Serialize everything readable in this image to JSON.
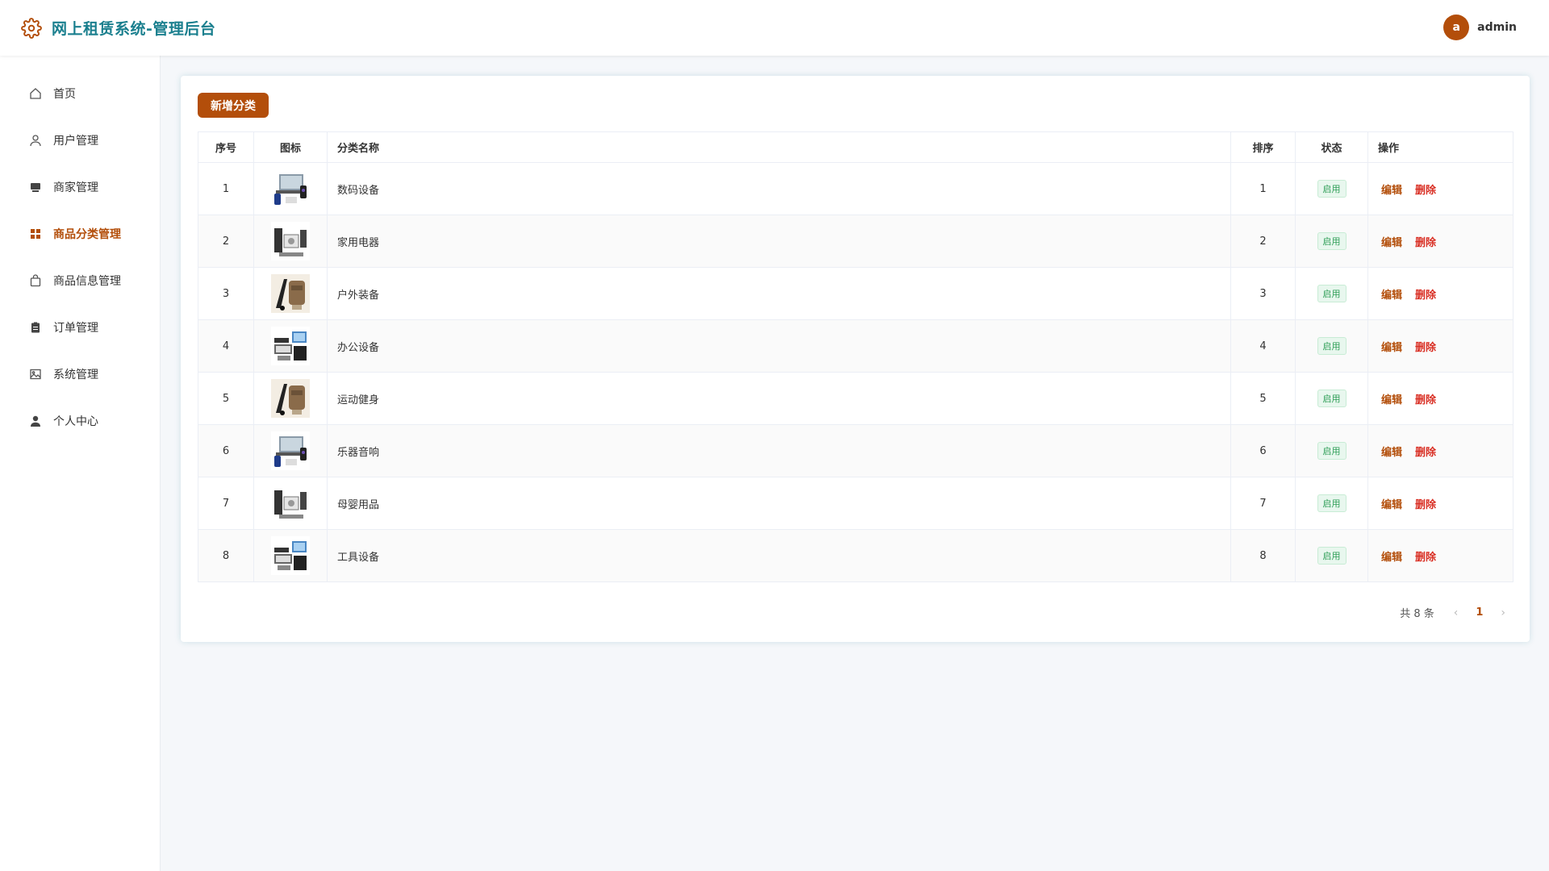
{
  "header": {
    "title": "网上租赁系统-管理后台",
    "brand_icon": "gear-icon",
    "user": {
      "avatar_letter": "a",
      "name": "admin"
    }
  },
  "colors": {
    "accent": "#b34e0a",
    "brand": "#1a7f8e",
    "success": "#2e9e57",
    "danger": "#d93025"
  },
  "sidebar": {
    "items": [
      {
        "label": "首页",
        "icon": "home-icon",
        "active": false
      },
      {
        "label": "用户管理",
        "icon": "user-icon",
        "active": false
      },
      {
        "label": "商家管理",
        "icon": "store-icon",
        "active": false
      },
      {
        "label": "商品分类管理",
        "icon": "grid-icon",
        "active": true
      },
      {
        "label": "商品信息管理",
        "icon": "shopping-bag-icon",
        "active": false
      },
      {
        "label": "订单管理",
        "icon": "clipboard-icon",
        "active": false
      },
      {
        "label": "系统管理",
        "icon": "image-icon",
        "active": false
      },
      {
        "label": "个人中心",
        "icon": "person-icon",
        "active": false
      }
    ]
  },
  "main": {
    "add_button": "新增分类",
    "table": {
      "headers": {
        "index": "序号",
        "icon": "图标",
        "name": "分类名称",
        "sort": "排序",
        "status": "状态",
        "actions": "操作"
      },
      "rows": [
        {
          "index": "1",
          "image": "electronics-thumbnail",
          "name": "数码设备",
          "sort": "1",
          "status": "启用",
          "edit": "编辑",
          "delete": "删除"
        },
        {
          "index": "2",
          "image": "appliance-thumbnail",
          "name": "家用电器",
          "sort": "2",
          "status": "启用",
          "edit": "编辑",
          "delete": "删除"
        },
        {
          "index": "3",
          "image": "outdoor-thumbnail",
          "name": "户外装备",
          "sort": "3",
          "status": "启用",
          "edit": "编辑",
          "delete": "删除"
        },
        {
          "index": "4",
          "image": "office-thumbnail",
          "name": "办公设备",
          "sort": "4",
          "status": "启用",
          "edit": "编辑",
          "delete": "删除"
        },
        {
          "index": "5",
          "image": "outdoor-thumbnail",
          "name": "运动健身",
          "sort": "5",
          "status": "启用",
          "edit": "编辑",
          "delete": "删除"
        },
        {
          "index": "6",
          "image": "electronics-thumbnail",
          "name": "乐器音响",
          "sort": "6",
          "status": "启用",
          "edit": "编辑",
          "delete": "删除"
        },
        {
          "index": "7",
          "image": "appliance-thumbnail",
          "name": "母婴用品",
          "sort": "7",
          "status": "启用",
          "edit": "编辑",
          "delete": "删除"
        },
        {
          "index": "8",
          "image": "office-thumbnail",
          "name": "工具设备",
          "sort": "8",
          "status": "启用",
          "edit": "编辑",
          "delete": "删除"
        }
      ]
    },
    "pagination": {
      "total": "共 8 条",
      "current_page": "1",
      "prev_icon": "chevron-left-icon",
      "next_icon": "chevron-right-icon"
    }
  }
}
